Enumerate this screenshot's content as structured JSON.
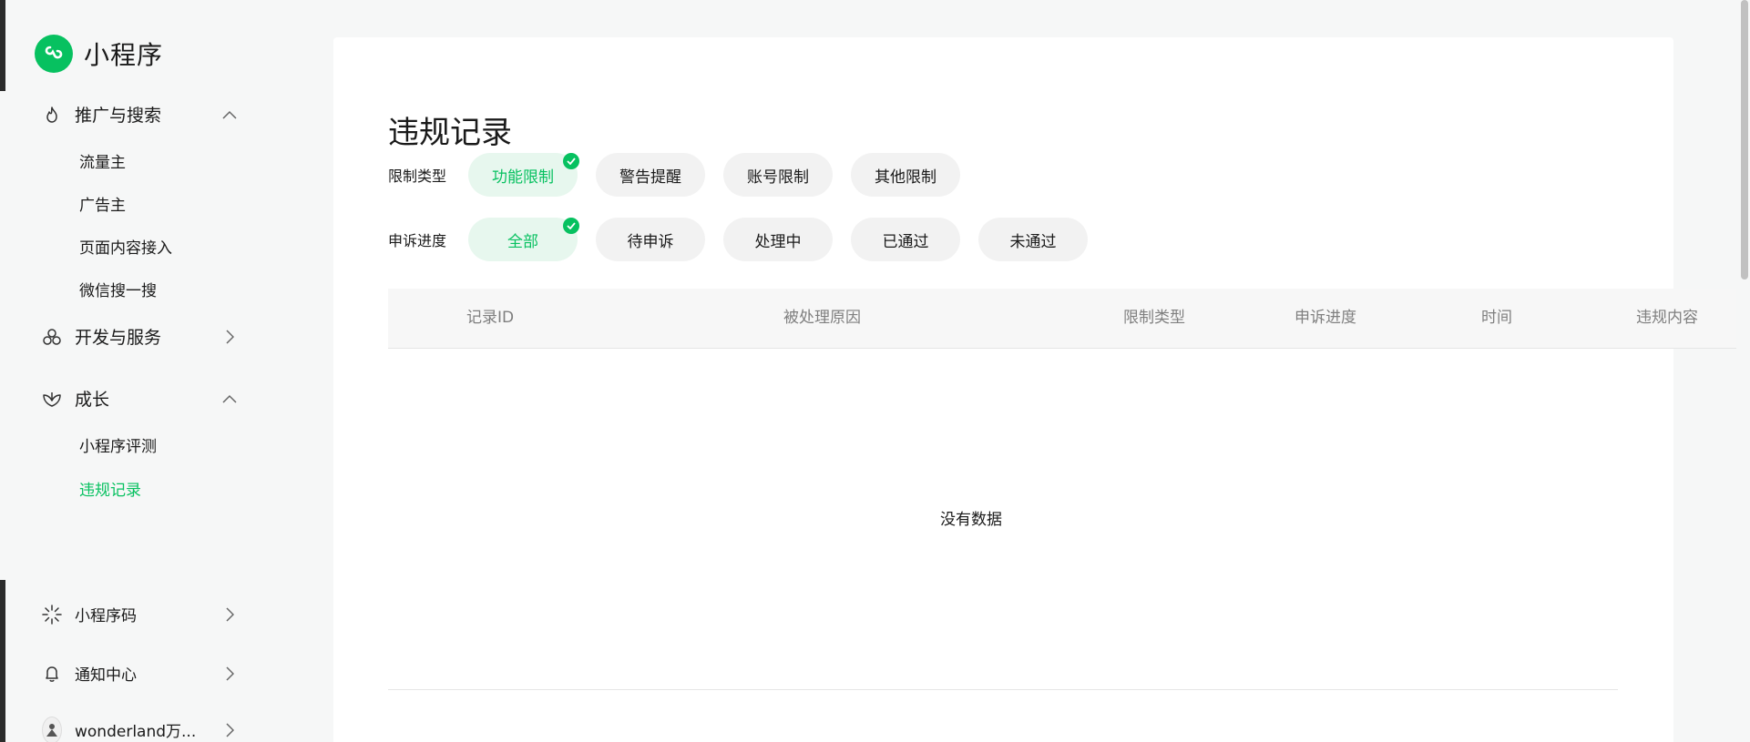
{
  "sidebar": {
    "brand_title": "小程序",
    "groups": [
      {
        "label": "推广与搜索",
        "icon": "flame-icon",
        "expanded": true,
        "items": [
          "流量主",
          "广告主",
          "页面内容接入",
          "微信搜一搜"
        ]
      },
      {
        "label": "开发与服务",
        "icon": "services-icon",
        "expanded": false,
        "items": []
      },
      {
        "label": "成长",
        "icon": "growth-icon",
        "expanded": true,
        "items": [
          "小程序评测",
          "违规记录"
        ]
      }
    ],
    "active_item": "违规记录",
    "bottom": [
      {
        "label": "小程序码",
        "icon": "qrcode-sparkle-icon"
      },
      {
        "label": "通知中心",
        "icon": "bell-icon"
      },
      {
        "label": "wonderland万...",
        "icon": "avatar"
      }
    ]
  },
  "main": {
    "title": "违规记录",
    "filters": {
      "restriction": {
        "label": "限制类型",
        "options": [
          "功能限制",
          "警告提醒",
          "账号限制",
          "其他限制"
        ],
        "selected": "功能限制"
      },
      "appeal": {
        "label": "申诉进度",
        "options": [
          "全部",
          "待申诉",
          "处理中",
          "已通过",
          "未通过"
        ],
        "selected": "全部"
      }
    },
    "table": {
      "columns": [
        "记录ID",
        "被处理原因",
        "限制类型",
        "申诉进度",
        "时间",
        "违规内容"
      ],
      "empty_text": "没有数据"
    }
  },
  "colors": {
    "accent": "#07c160",
    "chip_bg": "#f2f2f2",
    "chip_selected_bg": "#e7f7ee"
  }
}
